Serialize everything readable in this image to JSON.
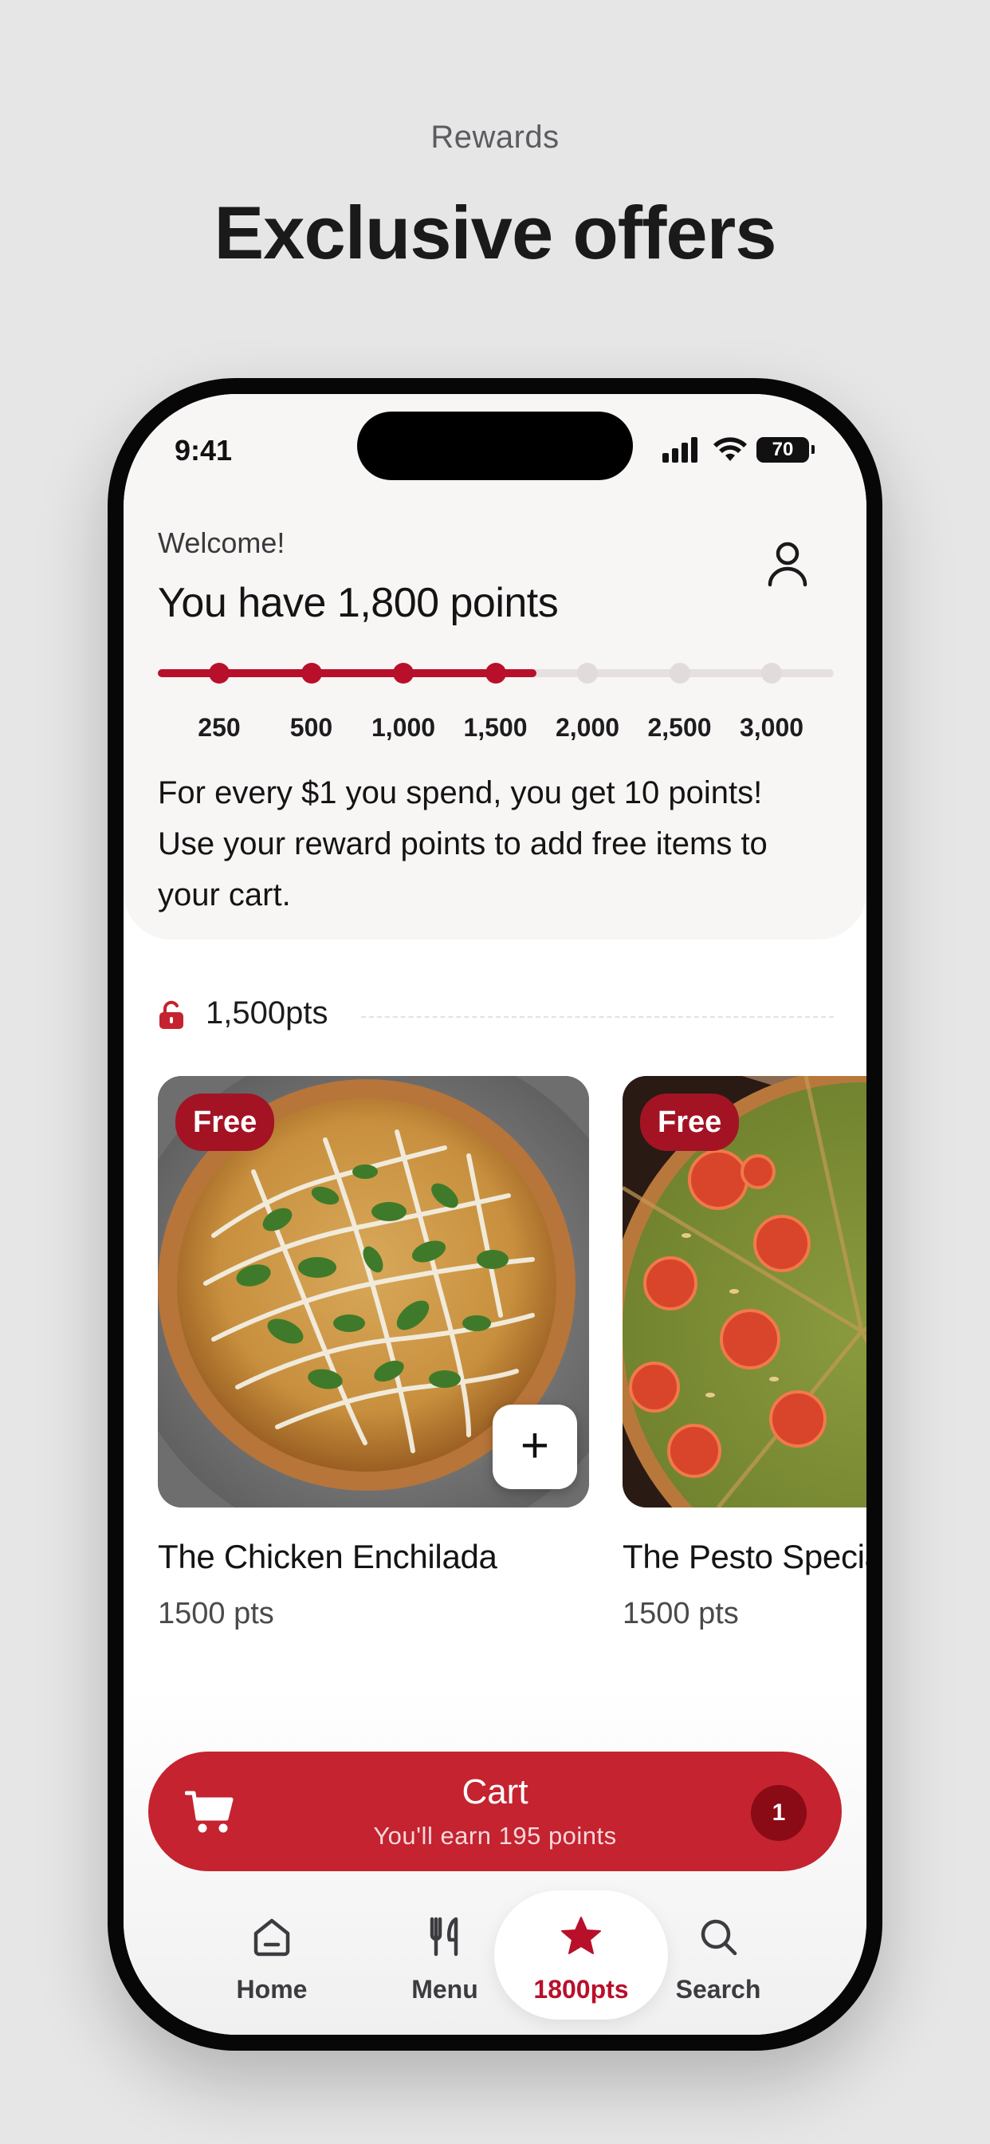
{
  "page": {
    "kicker": "Rewards",
    "title": "Exclusive offers"
  },
  "status_bar": {
    "time": "9:41",
    "battery": "70"
  },
  "rewards": {
    "welcome": "Welcome!",
    "points_title": "You have 1,800 points",
    "current_points": 1800,
    "max_points": 3000,
    "milestones": [
      "250",
      "500",
      "1,000",
      "1,500",
      "2,000",
      "2,500",
      "3,000"
    ],
    "milestones_reached": 4,
    "earn_text": "For every $1 you spend, you get 10 points! Use your reward points to add free items to your cart."
  },
  "tier": {
    "label": "1,500pts",
    "icon": "unlocked-lock-icon"
  },
  "products": [
    {
      "badge": "Free",
      "name": "The Chicken Enchilada",
      "points": "1500 pts",
      "image": "chicken-enchilada-pizza"
    },
    {
      "badge": "Free",
      "name": "The Pesto Special",
      "points": "1500 pts",
      "image": "pesto-tomato-pizza"
    }
  ],
  "cart": {
    "title": "Cart",
    "subtitle": "You'll earn 195 points",
    "count": "1"
  },
  "nav": {
    "items": [
      {
        "label": "Home",
        "icon": "home-icon"
      },
      {
        "label": "Menu",
        "icon": "utensils-icon"
      },
      {
        "label": "1800pts",
        "icon": "star-icon"
      },
      {
        "label": "Search",
        "icon": "search-icon"
      }
    ],
    "active_index": 2
  },
  "colors": {
    "brand_red": "#c4232f",
    "accent_red": "#b8102a",
    "badge_red": "#a31324",
    "background": "#e6e6e7"
  }
}
